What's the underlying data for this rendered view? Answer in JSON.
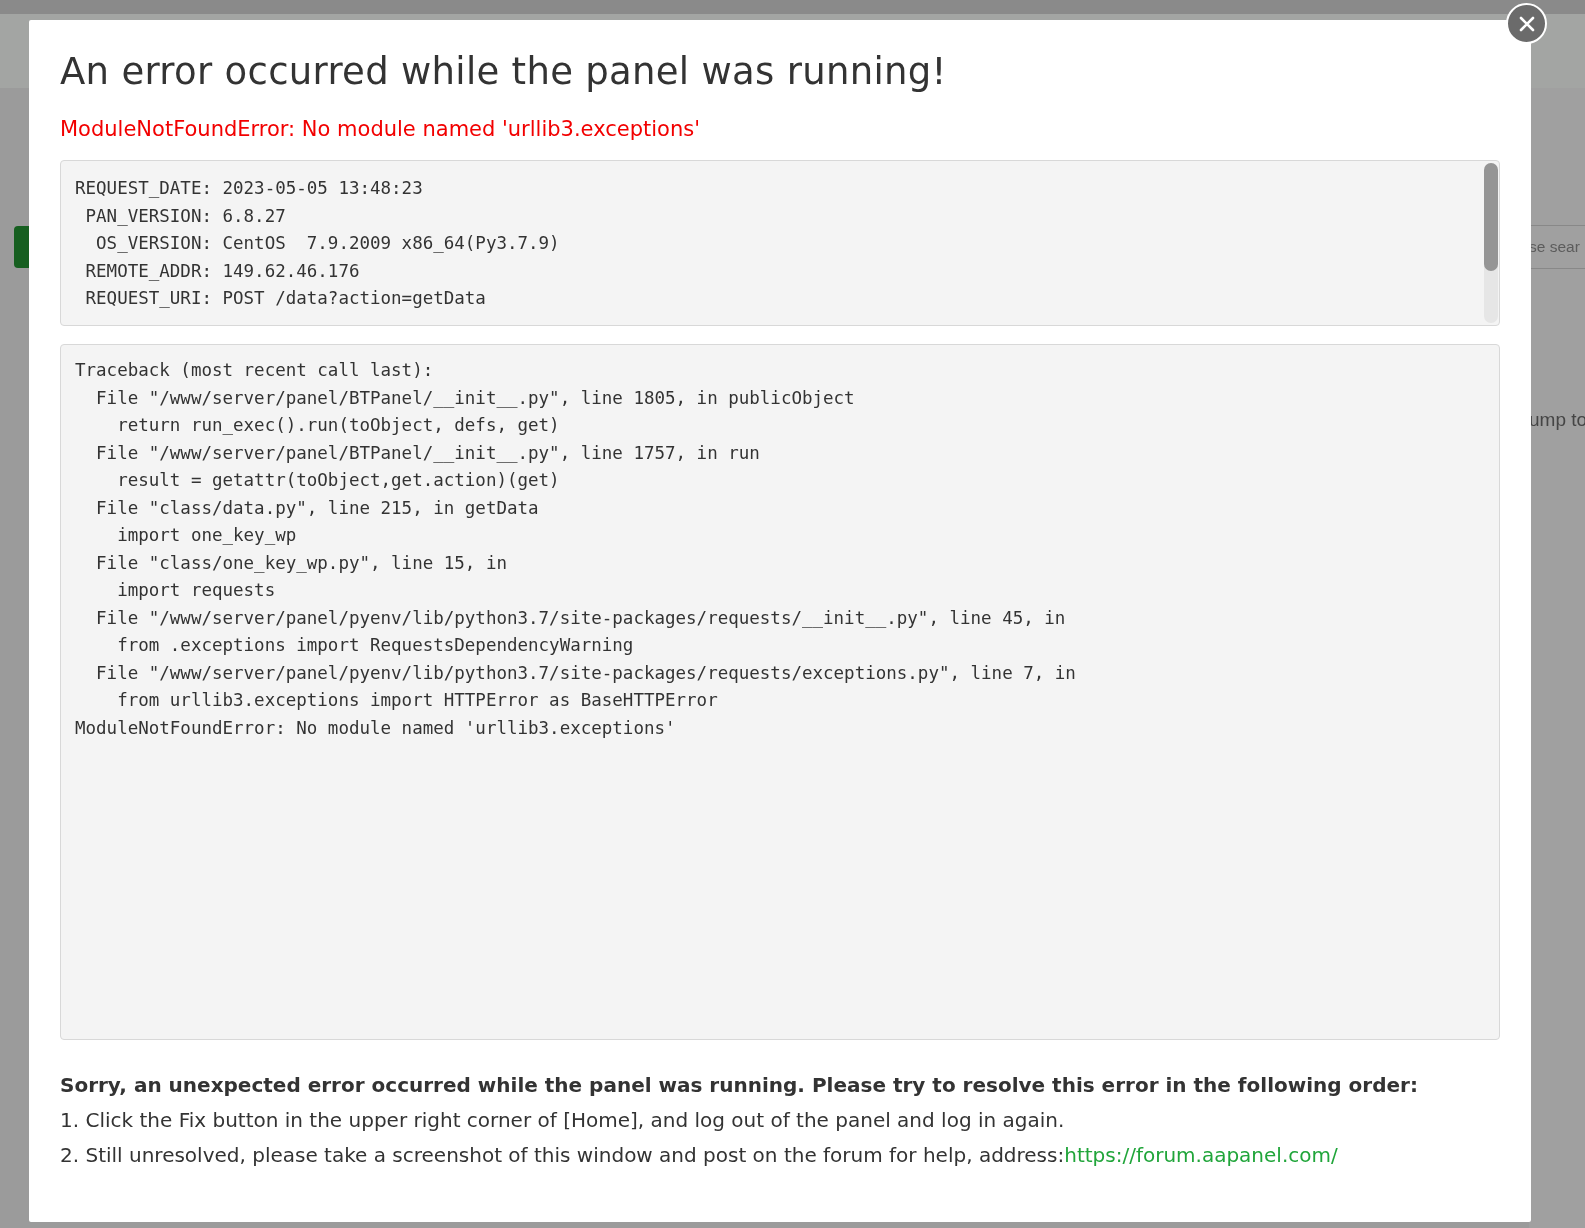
{
  "background": {
    "search_field": {
      "placeholder": "se sear"
    },
    "pagination_text": "ump to"
  },
  "dialog": {
    "title": "An error occurred while the panel was running!",
    "error": "ModuleNotFoundError: No module named 'urllib3.exceptions'",
    "request_info": [
      "REQUEST_DATE: 2023-05-05 13:48:23",
      " PAN_VERSION: 6.8.27",
      "  OS_VERSION: CentOS  7.9.2009 x86_64(Py3.7.9)",
      " REMOTE_ADDR: 149.62.46.176",
      " REQUEST_URI: POST /data?action=getData"
    ],
    "traceback": [
      "Traceback (most recent call last):",
      "  File \"/www/server/panel/BTPanel/__init__.py\", line 1805, in publicObject",
      "    return run_exec().run(toObject, defs, get)",
      "  File \"/www/server/panel/BTPanel/__init__.py\", line 1757, in run",
      "    result = getattr(toObject,get.action)(get)",
      "  File \"class/data.py\", line 215, in getData",
      "    import one_key_wp",
      "  File \"class/one_key_wp.py\", line 15, in",
      "    import requests",
      "  File \"/www/server/panel/pyenv/lib/python3.7/site-packages/requests/__init__.py\", line 45, in",
      "    from .exceptions import RequestsDependencyWarning",
      "  File \"/www/server/panel/pyenv/lib/python3.7/site-packages/requests/exceptions.py\", line 7, in",
      "    from urllib3.exceptions import HTTPError as BaseHTTPError",
      "ModuleNotFoundError: No module named 'urllib3.exceptions'"
    ],
    "help": {
      "heading": "Sorry, an unexpected error occurred while the panel was running. Please try to resolve this error in the following order:",
      "steps": [
        {
          "text": "1. Click the Fix button in the upper right corner of [Home], and log out of the panel and log in again."
        },
        {
          "text": "2. Still unresolved, please take a screenshot of this window and post on the forum for help, address:",
          "link": "https://forum.aapanel.com/"
        }
      ]
    }
  }
}
